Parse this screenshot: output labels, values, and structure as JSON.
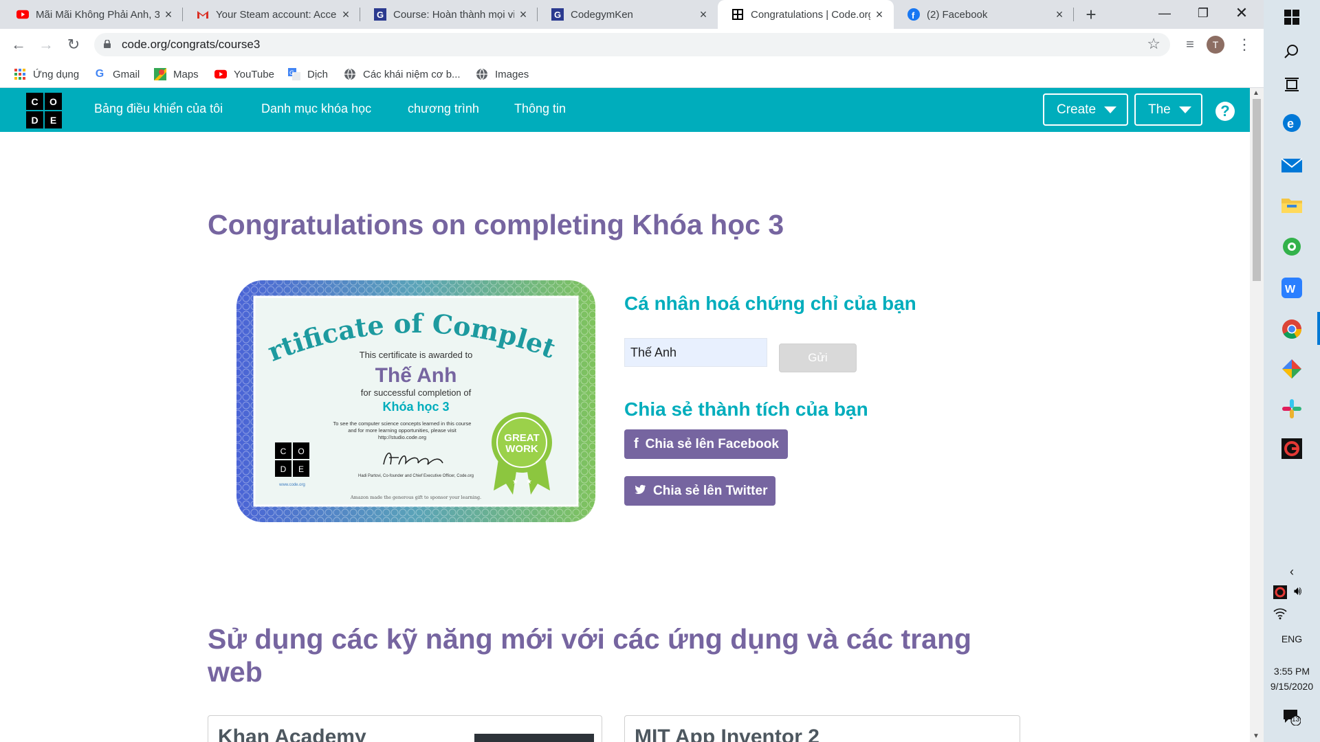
{
  "browser": {
    "tabs": [
      {
        "title": "Mãi Mãi Không Phải Anh, 3",
        "icon": "youtube-icon"
      },
      {
        "title": "Your Steam account: Acces",
        "icon": "gmail-icon"
      },
      {
        "title": "Course: Hoàn thành mọi vi",
        "icon": "codegym-icon"
      },
      {
        "title": "CodegymKen",
        "icon": "codegym-icon"
      },
      {
        "title": "Congratulations | Code.org",
        "icon": "codeorg-icon",
        "active": true
      },
      {
        "title": "(2) Facebook",
        "icon": "facebook-icon"
      }
    ],
    "url": "code.org/congrats/course3",
    "profile_initial": "T",
    "bookmarks": [
      {
        "label": "Ứng dụng",
        "icon": "apps-grid-icon"
      },
      {
        "label": "Gmail",
        "icon": "google-icon"
      },
      {
        "label": "Maps",
        "icon": "maps-icon"
      },
      {
        "label": "YouTube",
        "icon": "youtube-icon"
      },
      {
        "label": "Dịch",
        "icon": "translate-icon"
      },
      {
        "label": "Các khái niệm cơ b...",
        "icon": "globe-icon"
      },
      {
        "label": "Images",
        "icon": "globe-icon"
      }
    ]
  },
  "site": {
    "logo_letters": [
      "C",
      "O",
      "D",
      "E"
    ],
    "nav": [
      "Bảng điều khiển của tôi",
      "Danh mục khóa học",
      "chương trình",
      "Thông tin"
    ],
    "create_label": "Create",
    "user_label": "The",
    "help_label": "?"
  },
  "main": {
    "title": "Congratulations on completing Khóa học 3",
    "personalize_heading": "Cá nhân hoá chứng chỉ của bạn",
    "name_value": "Thế Anh",
    "send_label": "Gửi",
    "share_heading": "Chia sẻ thành tích của bạn",
    "share_facebook": "Chia sẻ lên Facebook",
    "share_twitter": "Chia sẻ lên Twitter",
    "apps_heading": "Sử dụng các kỹ năng mới với các ứng dụng và các trang web",
    "cards": [
      "Khan Academy",
      "MIT App Inventor 2"
    ]
  },
  "certificate": {
    "title": "Certificate of Completion",
    "awarded": "This certificate is awarded to",
    "name": "Thế Anh",
    "for": "for successful completion of",
    "course": "Khóa học 3",
    "info1": "To see the computer science concepts learned in this course",
    "info2": "and for more learning opportunities, please visit",
    "info3": "http://studio.code.org",
    "signer": "Hadi Partovi, Co-founder and Chief Executive Officer, Code.org",
    "site": "www.code.org",
    "footer": "Amazon made the generous gift to sponsor your learning.",
    "badge1": "GREAT",
    "badge2": "WORK"
  },
  "taskbar": {
    "lang": "ENG",
    "time": "3:55 PM",
    "date": "9/15/2020",
    "notifications": "13"
  },
  "colors": {
    "teal": "#00adbc",
    "purple": "#7665a0"
  }
}
